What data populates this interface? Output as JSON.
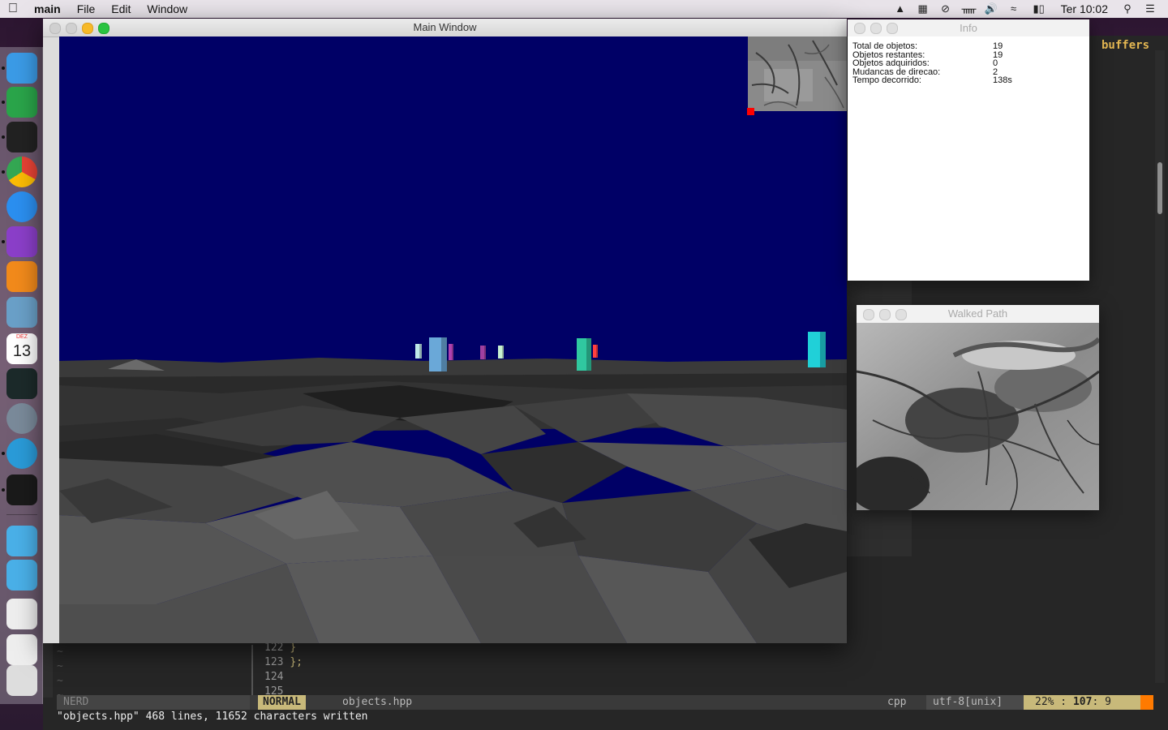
{
  "menubar": {
    "app_name": "main",
    "items": [
      "File",
      "Edit",
      "Window"
    ],
    "clock": "Ter 10:02"
  },
  "dock": {
    "items": [
      {
        "name": "finder",
        "color": "#3b9be6"
      },
      {
        "name": "vim",
        "color": "#2aa54a"
      },
      {
        "name": "terminal",
        "color": "#222222"
      },
      {
        "name": "chrome",
        "color": "#e84335"
      },
      {
        "name": "safari",
        "color": "#2b8ff0"
      },
      {
        "name": "dash",
        "color": "#8b3fc9"
      },
      {
        "name": "vlc",
        "color": "#f28a1b"
      },
      {
        "name": "preview",
        "color": "#6aa0c8"
      },
      {
        "name": "calendar",
        "color": "#ffffff"
      },
      {
        "name": "activity-monitor",
        "color": "#1c2a2a"
      },
      {
        "name": "launchpad",
        "color": "#7a8a9a"
      },
      {
        "name": "markdown",
        "color": "#2a9bd8"
      },
      {
        "name": "exec",
        "color": "#1a1a1a"
      },
      {
        "name": "applications-folder",
        "color": "#4ab0e8"
      },
      {
        "name": "downloads-folder",
        "color": "#4ab0e8"
      },
      {
        "name": "chrome-doc",
        "color": "#eeeeee"
      },
      {
        "name": "document",
        "color": "#eeeeee"
      },
      {
        "name": "trash",
        "color": "#dddddd"
      }
    ],
    "calendar_month": "DEZ",
    "calendar_day": "13"
  },
  "main_window": {
    "title": "Main Window"
  },
  "info_window": {
    "title": "Info",
    "rows": [
      {
        "label": "Total de objetos:",
        "value": "19"
      },
      {
        "label": "Objetos restantes:",
        "value": "19"
      },
      {
        "label": "Objetos adquiridos:",
        "value": "0"
      },
      {
        "label": "Mudancas de direcao:",
        "value": "2"
      },
      {
        "label": "Tempo decorrido:",
        "value": "138s"
      }
    ]
  },
  "walked_path_window": {
    "title": "Walked Path"
  },
  "vim": {
    "buffers_label": "buffers",
    "lines": [
      {
        "num": "122",
        "text": "    }"
      },
      {
        "num": "123",
        "text": "};"
      },
      {
        "num": "124",
        "text": ""
      },
      {
        "num": "125",
        "text": ""
      }
    ],
    "status": {
      "nerd": "NERD",
      "mode": "NORMAL",
      "file": "objects.hpp",
      "filetype": "cpp",
      "encoding": "utf-8[unix]",
      "position_pct": "22% :",
      "position_line": "107",
      "position_col": ":  9"
    },
    "cmdline": "\"objects.hpp\" 468 lines, 11652 characters written"
  },
  "scene_objects": [
    {
      "color": "#bfe8e8"
    },
    {
      "color": "#6aa8d8"
    },
    {
      "color": "#b040b0"
    },
    {
      "color": "#a040a0"
    },
    {
      "color": "#c8f0d0"
    },
    {
      "color": "#30c8a0"
    },
    {
      "color": "#ff4040"
    },
    {
      "color": "#20d0d8"
    }
  ]
}
